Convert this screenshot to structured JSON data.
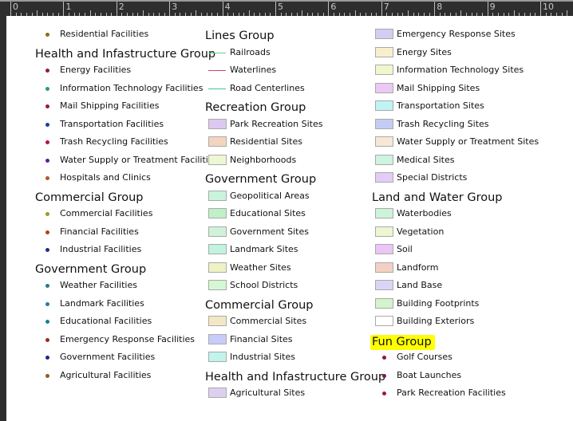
{
  "ruler": {
    "labels": [
      "0",
      "1",
      "2",
      "3",
      "4",
      "5",
      "6",
      "7",
      "8",
      "9",
      "10"
    ]
  },
  "columns": [
    [
      {
        "type": "point",
        "label": "Residential Facilities",
        "color": "#8a6d1e"
      },
      {
        "type": "heading",
        "label": "Health and Infastructure Group"
      },
      {
        "type": "point",
        "label": "Energy Facilities",
        "color": "#8b1a4a"
      },
      {
        "type": "point",
        "label": "Information Technology Facilities",
        "color": "#2aa06a"
      },
      {
        "type": "point",
        "label": "Mail Shipping Facilities",
        "color": "#9b1b30"
      },
      {
        "type": "point",
        "label": "Transportation Facilities",
        "color": "#1b3f9b"
      },
      {
        "type": "point",
        "label": "Trash Recycling Facilities",
        "color": "#b01838"
      },
      {
        "type": "point",
        "label": "Water Supply or Treatment Facilities",
        "color": "#5a1fa0"
      },
      {
        "type": "point",
        "label": "Hospitals and Clinics",
        "color": "#b0582a"
      },
      {
        "type": "heading",
        "label": "Commercial Group"
      },
      {
        "type": "point",
        "label": "Commercial Facilities",
        "color": "#a09a20"
      },
      {
        "type": "point",
        "label": "Financial Facilities",
        "color": "#b0401a"
      },
      {
        "type": "point",
        "label": "Industrial Facilities",
        "color": "#1a3080"
      },
      {
        "type": "heading",
        "label": "Government Group"
      },
      {
        "type": "point",
        "label": "Weather Facilities",
        "color": "#2a7a8a"
      },
      {
        "type": "point",
        "label": "Landmark Facilities",
        "color": "#2a7aa0"
      },
      {
        "type": "point",
        "label": "Educational Facilities",
        "color": "#1a8090"
      },
      {
        "type": "point",
        "label": "Emergency Response Facilities",
        "color": "#a02a1a"
      },
      {
        "type": "point",
        "label": "Government Facilities",
        "color": "#1a2a90"
      },
      {
        "type": "point",
        "label": "Agricultural Facilities",
        "color": "#905a2a"
      }
    ],
    [
      {
        "type": "heading",
        "label": "Lines Group"
      },
      {
        "type": "line",
        "label": "Railroads",
        "color": "#5fd08f"
      },
      {
        "type": "line",
        "label": "Waterlines",
        "color": "#d04070"
      },
      {
        "type": "line",
        "label": "Road Centerlines",
        "color": "#40c890"
      },
      {
        "type": "heading",
        "label": "Recreation Group"
      },
      {
        "type": "polygon",
        "label": "Park Recreation Sites",
        "color": "#dcc8f0"
      },
      {
        "type": "polygon",
        "label": "Residential Sites",
        "color": "#f2d4c0"
      },
      {
        "type": "polygon",
        "label": "Neighborhoods",
        "color": "#eef7d4"
      },
      {
        "type": "heading",
        "label": "Government Group"
      },
      {
        "type": "polygon",
        "label": "Geopolitical Areas",
        "color": "#c8f4dc"
      },
      {
        "type": "polygon",
        "label": "Educational Sites",
        "color": "#c0f0c8"
      },
      {
        "type": "polygon",
        "label": "Government Sites",
        "color": "#d0f2d8"
      },
      {
        "type": "polygon",
        "label": "Landmark Sites",
        "color": "#c0f4e0"
      },
      {
        "type": "polygon",
        "label": "Weather Sites",
        "color": "#eef2c4"
      },
      {
        "type": "polygon",
        "label": "School Districts",
        "color": "#d4f8d4"
      },
      {
        "type": "heading",
        "label": "Commercial Group"
      },
      {
        "type": "polygon",
        "label": "Commercial Sites",
        "color": "#f4e8c4"
      },
      {
        "type": "polygon",
        "label": "Financial Sites",
        "color": "#c8ccf8"
      },
      {
        "type": "polygon",
        "label": "Industrial Sites",
        "color": "#c0f4ec"
      },
      {
        "type": "heading",
        "label": "Health and Infastructure Group"
      },
      {
        "type": "polygon",
        "label": "Agricultural Sites",
        "color": "#dcd0f0"
      }
    ],
    [
      {
        "type": "polygon",
        "label": "Emergency Response Sites",
        "color": "#d4ccf4"
      },
      {
        "type": "polygon",
        "label": "Energy Sites",
        "color": "#f8f0cc"
      },
      {
        "type": "polygon",
        "label": "Information Technology Sites",
        "color": "#f2f6cc"
      },
      {
        "type": "polygon",
        "label": "Mail Shipping Sites",
        "color": "#ecc8f4"
      },
      {
        "type": "polygon",
        "label": "Transportation Sites",
        "color": "#c0f4f4"
      },
      {
        "type": "polygon",
        "label": "Trash Recycling Sites",
        "color": "#c4ccf4"
      },
      {
        "type": "polygon",
        "label": "Water Supply or Treatment Sites",
        "color": "#f6e8d4"
      },
      {
        "type": "polygon",
        "label": "Medical Sites",
        "color": "#ccf4e0"
      },
      {
        "type": "polygon",
        "label": "Special Districts",
        "color": "#e4ccf6"
      },
      {
        "type": "heading",
        "label": "Land and Water Group"
      },
      {
        "type": "polygon",
        "label": "Waterbodies",
        "color": "#ccf4d8"
      },
      {
        "type": "polygon",
        "label": "Vegetation",
        "color": "#ecf6d0"
      },
      {
        "type": "polygon",
        "label": "Soil",
        "color": "#ecc4f6"
      },
      {
        "type": "polygon",
        "label": "Landform",
        "color": "#f4d0c4"
      },
      {
        "type": "polygon",
        "label": "Land Base",
        "color": "#dcd4f6"
      },
      {
        "type": "polygon",
        "label": "Building Footprints",
        "color": "#d4f4cc"
      },
      {
        "type": "polygon",
        "label": "Building Exteriors",
        "color": "#ffffff"
      },
      {
        "type": "heading",
        "label": "Fun Group",
        "highlight": "#ffff00"
      },
      {
        "type": "point",
        "label": "Golf Courses",
        "color": "#8b1a3a"
      },
      {
        "type": "point",
        "label": "Boat Launches",
        "color": "#7a1a5a"
      },
      {
        "type": "point",
        "label": "Park Recreation Facilities",
        "color": "#9b1a3a"
      }
    ]
  ]
}
